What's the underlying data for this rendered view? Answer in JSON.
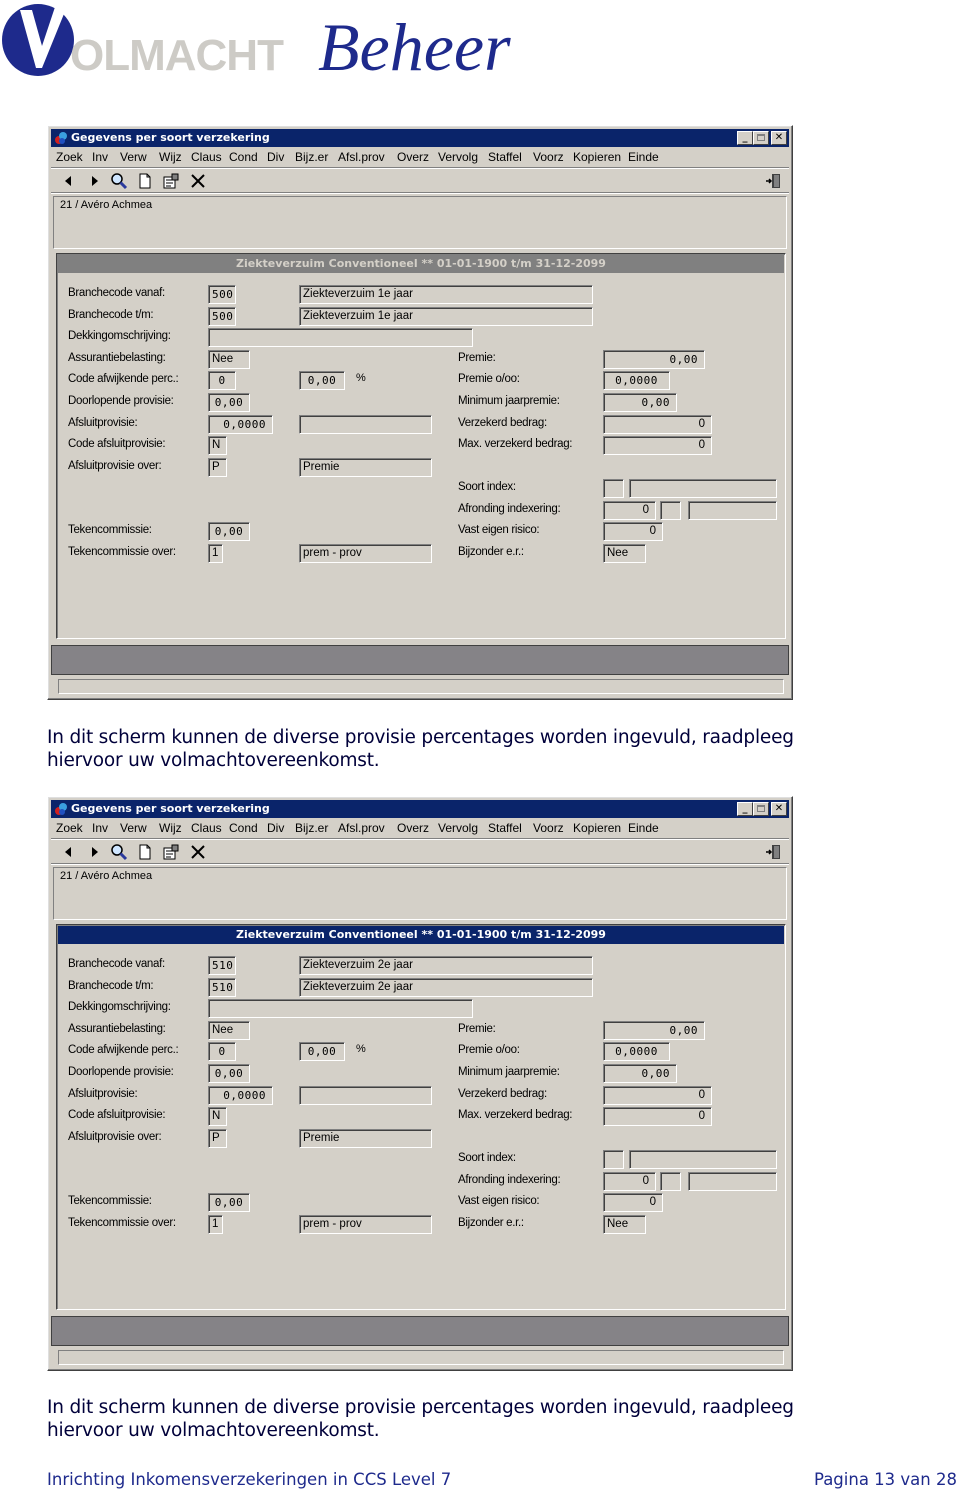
{
  "logo": {
    "mark": "V",
    "word1": "OLMACHT",
    "word2": "Beheer"
  },
  "colors": {
    "titlebar": "#0a246a",
    "window_bg": "#d4d0c8",
    "section_inactive": "#808080",
    "status_bar": "#858387",
    "footer_text": "#1e2a8c"
  },
  "windows": [
    {
      "title": "Gegevens per soort verzekering",
      "menu": [
        "Zoek",
        "Inv",
        "Verw",
        "Wijz",
        "Claus",
        "Cond",
        "Div",
        "Bijz.er",
        "Afsl.prov",
        "Overz",
        "Vervolg",
        "Staffel",
        "Voorz",
        "Kopieren",
        "Einde"
      ],
      "toolbar_icons": [
        "prev-arrow-icon",
        "next-arrow-icon",
        "search-icon",
        "new-document-icon",
        "properties-icon",
        "delete-icon",
        "exit-door-icon"
      ],
      "info": "21 / Avéro Achmea",
      "section_title": "Ziekteverzuim Conventioneel ** 01-01-1900 t/m 31-12-2099",
      "section_active": false,
      "left": {
        "branchecode_vanaf": {
          "label": "Branchecode vanaf:",
          "code": "500",
          "desc": "Ziekteverzuim 1e jaar"
        },
        "branchecode_tm": {
          "label": "Branchecode t/m:",
          "code": "500",
          "desc": "Ziekteverzuim 1e jaar"
        },
        "dekking": {
          "label": "Dekkingomschrijving:",
          "value": ""
        },
        "assurantie": {
          "label": "Assurantiebelasting:",
          "value": "Nee"
        },
        "code_afw": {
          "label": "Code afwijkende perc.:",
          "value": "0",
          "perc": "0,00",
          "unit": "%"
        },
        "doorlopende": {
          "label": "Doorlopende provisie:",
          "value": "0,00"
        },
        "afsluitprov": {
          "label": "Afsluitprovisie:",
          "value": "0,0000",
          "extra": ""
        },
        "code_afsluit": {
          "label": "Code afsluitprovisie:",
          "value": "N"
        },
        "afsluit_over": {
          "label": "Afsluitprovisie over:",
          "code": "P",
          "desc": "Premie"
        },
        "tekencomm": {
          "label": "Tekencommissie:",
          "value": "0,00"
        },
        "tekencomm_over": {
          "label": "Tekencommissie over:",
          "code": "1",
          "desc": "prem - prov"
        }
      },
      "right": {
        "premie": {
          "label": "Premie:",
          "value": "0,00"
        },
        "premie_oo": {
          "label": "Premie o/oo:",
          "value": "0,0000"
        },
        "min_jaarpremie": {
          "label": "Minimum jaarpremie:",
          "value": "0,00"
        },
        "verzekerd": {
          "label": "Verzekerd bedrag:",
          "value": "0"
        },
        "max_verzekerd": {
          "label": "Max. verzekerd bedrag:",
          "value": "0"
        },
        "soort_index": {
          "label": "Soort index:",
          "code": "",
          "desc": ""
        },
        "afronding": {
          "label": "Afronding indexering:",
          "value": "0",
          "code": "",
          "desc": ""
        },
        "vast_er": {
          "label": "Vast eigen risico:",
          "value": "0"
        },
        "bijzonder_er": {
          "label": "Bijzonder e.r.:",
          "value": "Nee"
        }
      }
    },
    {
      "title": "Gegevens per soort verzekering",
      "menu": [
        "Zoek",
        "Inv",
        "Verw",
        "Wijz",
        "Claus",
        "Cond",
        "Div",
        "Bijz.er",
        "Afsl.prov",
        "Overz",
        "Vervolg",
        "Staffel",
        "Voorz",
        "Kopieren",
        "Einde"
      ],
      "toolbar_icons": [
        "prev-arrow-icon",
        "next-arrow-icon",
        "search-icon",
        "new-document-icon",
        "properties-icon",
        "delete-icon",
        "exit-door-icon"
      ],
      "info": "21 / Avéro Achmea",
      "section_title": "Ziekteverzuim Conventioneel ** 01-01-1900 t/m 31-12-2099",
      "section_active": true,
      "left": {
        "branchecode_vanaf": {
          "label": "Branchecode vanaf:",
          "code": "510",
          "desc": "Ziekteverzuim 2e jaar"
        },
        "branchecode_tm": {
          "label": "Branchecode t/m:",
          "code": "510",
          "desc": "Ziekteverzuim 2e jaar"
        },
        "dekking": {
          "label": "Dekkingomschrijving:",
          "value": ""
        },
        "assurantie": {
          "label": "Assurantiebelasting:",
          "value": "Nee"
        },
        "code_afw": {
          "label": "Code afwijkende perc.:",
          "value": "0",
          "perc": "0,00",
          "unit": "%"
        },
        "doorlopende": {
          "label": "Doorlopende provisie:",
          "value": "0,00"
        },
        "afsluitprov": {
          "label": "Afsluitprovisie:",
          "value": "0,0000",
          "extra": ""
        },
        "code_afsluit": {
          "label": "Code afsluitprovisie:",
          "value": "N"
        },
        "afsluit_over": {
          "label": "Afsluitprovisie over:",
          "code": "P",
          "desc": "Premie"
        },
        "tekencomm": {
          "label": "Tekencommissie:",
          "value": "0,00"
        },
        "tekencomm_over": {
          "label": "Tekencommissie over:",
          "code": "1",
          "desc": "prem - prov"
        }
      },
      "right": {
        "premie": {
          "label": "Premie:",
          "value": "0,00"
        },
        "premie_oo": {
          "label": "Premie o/oo:",
          "value": "0,0000"
        },
        "min_jaarpremie": {
          "label": "Minimum jaarpremie:",
          "value": "0,00"
        },
        "verzekerd": {
          "label": "Verzekerd bedrag:",
          "value": "0"
        },
        "max_verzekerd": {
          "label": "Max. verzekerd bedrag:",
          "value": "0"
        },
        "soort_index": {
          "label": "Soort index:",
          "code": "",
          "desc": ""
        },
        "afronding": {
          "label": "Afronding indexering:",
          "value": "0",
          "code": "",
          "desc": ""
        },
        "vast_er": {
          "label": "Vast eigen risico:",
          "value": "0"
        },
        "bijzonder_er": {
          "label": "Bijzonder e.r.:",
          "value": "Nee"
        }
      }
    }
  ],
  "paragraphs": [
    {
      "line1": "In dit scherm kunnen de diverse provisie percentages worden ingevuld, raadpleeg",
      "line2": "hiervoor uw volmachtovereenkomst."
    },
    {
      "line1": "In dit scherm kunnen de diverse provisie percentages worden ingevuld, raadpleeg",
      "line2": "hiervoor uw volmachtovereenkomst."
    }
  ],
  "footer": {
    "left": "Inrichting Inkomensverzekeringen in CCS Level 7",
    "right": "Pagina 13 van 28"
  }
}
